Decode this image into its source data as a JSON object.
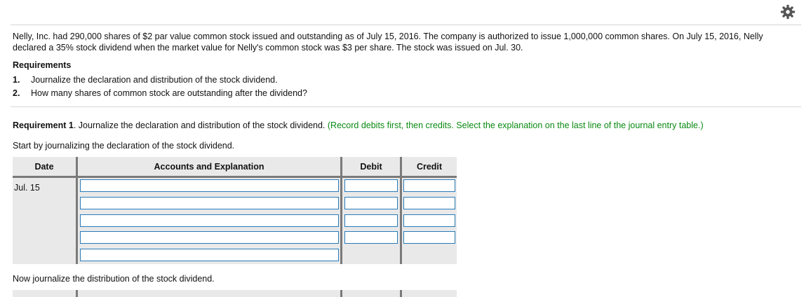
{
  "toolbar": {
    "settings_icon": "gear-icon"
  },
  "problem": {
    "intro": "Nelly, Inc. had 290,000 shares of $2 par value common stock issued and outstanding as of July 15, 2016. The company is authorized to issue 1,000,000 common shares. On July 15, 2016, Nelly declared a 35% stock dividend when the market value for Nelly's common stock was $3 per share. The stock was issued on Jul. 30.",
    "requirements_heading": "Requirements",
    "requirements": [
      {
        "num": "1.",
        "text": "Journalize the declaration and distribution of the stock dividend."
      },
      {
        "num": "2.",
        "text": "How many shares of common stock are outstanding after the dividend?"
      }
    ]
  },
  "requirement1": {
    "label": "Requirement 1",
    "text": ". Journalize the declaration and distribution of the stock dividend.",
    "instruction": "(Record debits first, then credits. Select the explanation on the last line of the journal entry table.)",
    "start_text": "Start by journalizing the declaration of the stock dividend.",
    "now_text": "Now journalize the distribution of the stock dividend."
  },
  "journal": {
    "headers": {
      "date": "Date",
      "accounts": "Accounts and Explanation",
      "debit": "Debit",
      "credit": "Credit"
    },
    "declaration": {
      "date": "Jul. 15",
      "rows": [
        "",
        "",
        "",
        "",
        ""
      ]
    }
  },
  "colors": {
    "instruction_green": "#0a8a12",
    "input_border": "#2a7bb8",
    "table_bg": "#e9e9e9",
    "divider": "#7a7a7a"
  }
}
